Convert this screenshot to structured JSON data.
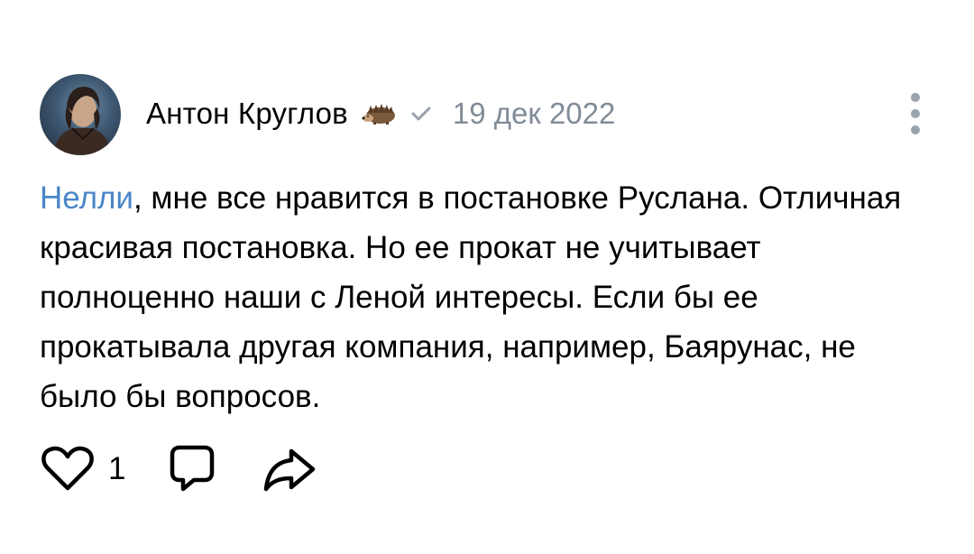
{
  "comment": {
    "author": "Антон Круглов",
    "date": "19 дек 2022",
    "mention": "Нелли",
    "text_after_mention": ", мне все нравится в постановке Руслана. Отличная красивая постановка. Но ее прокат не учитывает полноценно наши с Леной интересы. Если бы ее прокатывала другая компания, например, Баярунас, не было бы вопросов.",
    "likes": "1",
    "icons": {
      "avatar": "user-avatar",
      "badge": "hedgehog-icon",
      "verified": "checkmark-icon",
      "more": "more-vertical-icon",
      "like": "heart-icon",
      "reply": "comment-icon",
      "share": "share-icon"
    },
    "colors": {
      "mention": "#4a86c8",
      "meta": "#818c99",
      "icon": "#000000"
    }
  }
}
